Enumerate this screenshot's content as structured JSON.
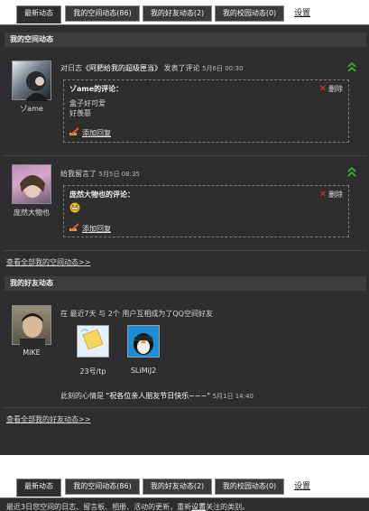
{
  "tabs": [
    {
      "label": "最新动态"
    },
    {
      "label": "我的空间动态(86)"
    },
    {
      "label": "我的好友动态(2)"
    },
    {
      "label": "我的校园动态(0)"
    }
  ],
  "settings_link": "设置",
  "space_section": {
    "title": "我的空间动态",
    "items": [
      {
        "user": "ゾame",
        "action_prefix": "对日志",
        "action_link": "《阿肥给我的超级匣当》",
        "action_suffix": "发表了评论",
        "time": "5月6日 00:30",
        "comment_title": "ゾame的评论：",
        "comment_lines": [
          "盒子好可爱",
          "好羡慕"
        ],
        "delete_label": "删除",
        "reply_label": "添加回复"
      },
      {
        "user": "庞然大物也",
        "action_prefix": "给我留言了",
        "time": "5月5日 08:35",
        "comment_title": "庞然大物也的评论：",
        "delete_label": "删除",
        "reply_label": "添加回复"
      }
    ],
    "more_link": "查看全部我的空间动态>>"
  },
  "friend_section": {
    "title": "我的好友动态",
    "user": "MiKE",
    "summary": "在 最近7天 与 2个 用户互相成为了QQ空间好友",
    "friends": [
      {
        "name": "23号/tp"
      },
      {
        "name": "SLiMiJ2"
      }
    ],
    "mood_prefix": "此刻的心情是",
    "mood_text": "\"祝各位亲人朋友节日快乐~~~\"",
    "mood_time": "5月1日 14:40",
    "more_link": "查看全部我的好友动态>>"
  },
  "bottom": {
    "hint_prefix": "最近3日您空间的日志、留言板、相册、活动的更新，重新",
    "hint_link": "设置",
    "hint_suffix": "关注的类别。"
  },
  "colors": {
    "panel_bg": "#2e2e30",
    "delete_x": "#e03a2a",
    "collapse_arrow": "#3fae2a"
  },
  "icons": [
    "collapse-up-icon",
    "delete-x-icon",
    "pen-reply-icon",
    "smiley-icon",
    "yellow-note-icon",
    "qq-penguin-icon"
  ]
}
